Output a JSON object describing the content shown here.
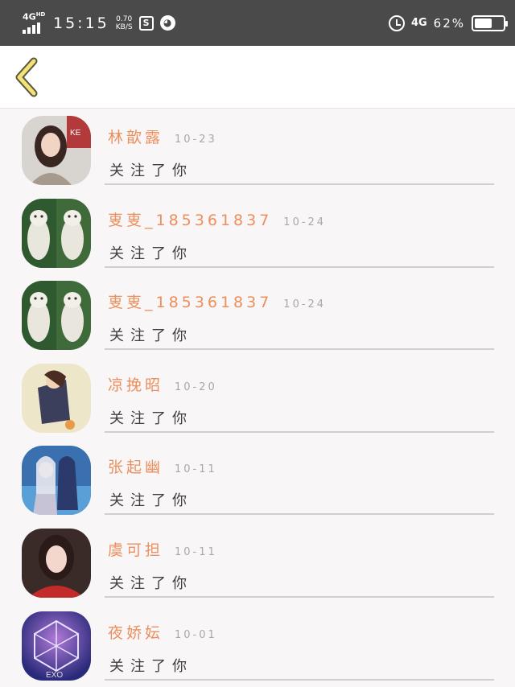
{
  "status_bar": {
    "network": "4G",
    "network_sup": "HD",
    "time": "15:15",
    "speed_value": "0.70",
    "speed_unit": "KB/S",
    "mobile_type": "4G",
    "battery_percent": "62%",
    "battery_level": 0.62
  },
  "notifications": [
    {
      "name": "林歆露",
      "date": "10-23",
      "action": "关注了你",
      "avatar": "avatar-woman-brown-hair"
    },
    {
      "name": "叓叓_185361837",
      "date": "10-24",
      "action": "关注了你",
      "avatar": "avatar-cats"
    },
    {
      "name": "叓叓_185361837",
      "date": "10-24",
      "action": "关注了你",
      "avatar": "avatar-cats"
    },
    {
      "name": "凉挽昭",
      "date": "10-20",
      "action": "关注了你",
      "avatar": "avatar-anime-girl"
    },
    {
      "name": "张起幽",
      "date": "10-11",
      "action": "关注了你",
      "avatar": "avatar-anime-couple"
    },
    {
      "name": "虞可担",
      "date": "10-11",
      "action": "关注了你",
      "avatar": "avatar-woman-red"
    },
    {
      "name": "夜娇妘",
      "date": "10-01",
      "action": "关注了你",
      "avatar": "avatar-exo-logo"
    }
  ],
  "colors": {
    "status_bar_bg": "#4a4a4a",
    "name_color": "#ec8f5e",
    "date_color": "#a8a8a8",
    "back_arrow_fill": "#f3e27a",
    "back_arrow_stroke": "#5a5a3a"
  }
}
